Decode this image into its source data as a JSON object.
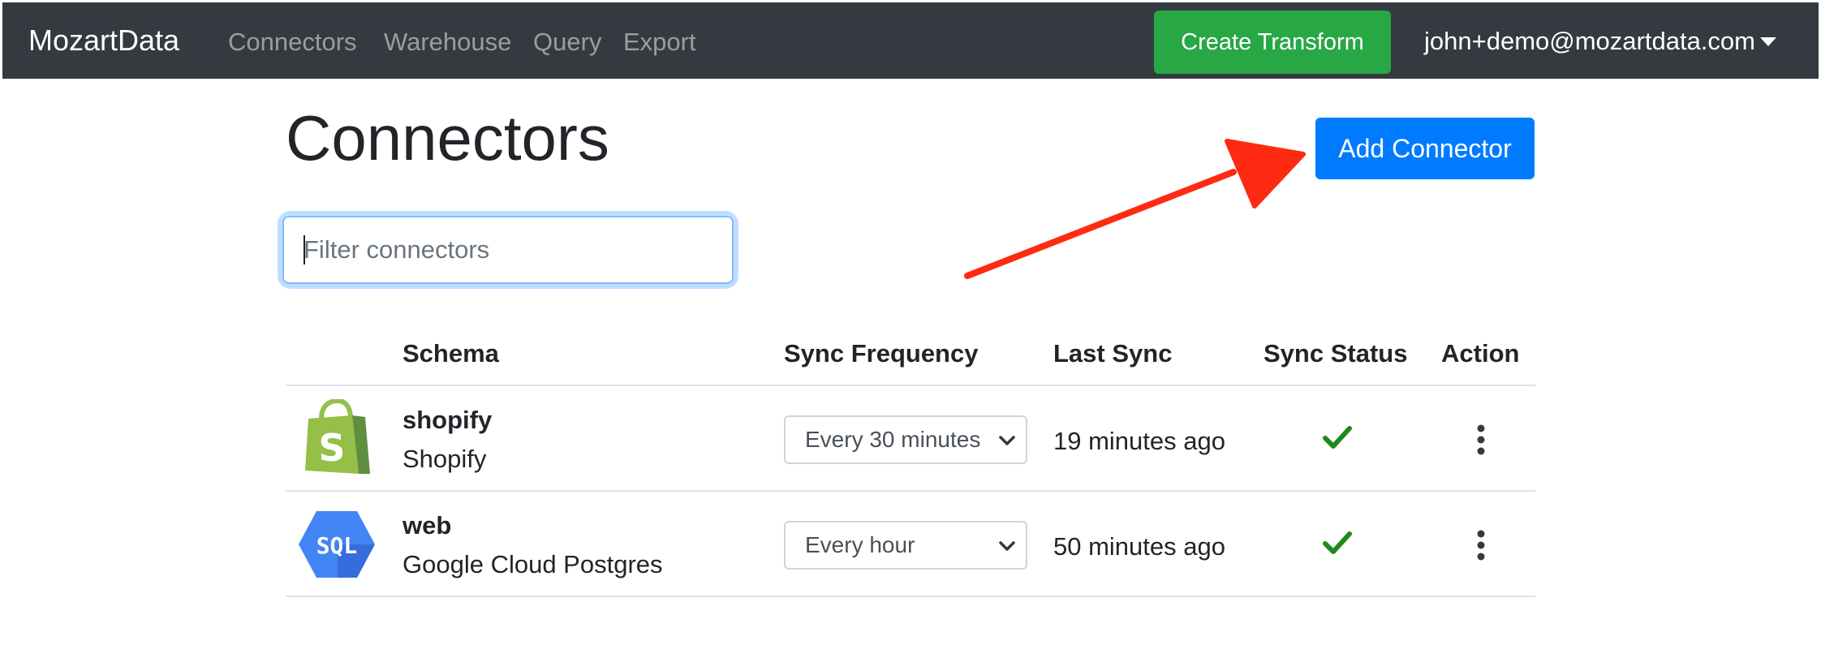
{
  "navbar": {
    "brand": "MozartData",
    "links": [
      "Connectors",
      "Warehouse",
      "Query",
      "Export"
    ],
    "create_button": "Create Transform",
    "user_email": "john+demo@mozartdata.com"
  },
  "page": {
    "title": "Connectors",
    "add_button": "Add Connector",
    "filter_placeholder": "Filter connectors"
  },
  "table": {
    "headers": {
      "schema": "Schema",
      "sync_frequency": "Sync Frequency",
      "last_sync": "Last Sync",
      "sync_status": "Sync Status",
      "action": "Action"
    },
    "rows": [
      {
        "name": "shopify",
        "service": "Shopify",
        "logo": "shopify-logo",
        "sync_frequency": "Every 30 minutes",
        "last_sync": "19 minutes ago",
        "status": "success-check-icon"
      },
      {
        "name": "web",
        "service": "Google Cloud Postgres",
        "logo": "google-cloud-sql-logo",
        "sync_frequency": "Every hour",
        "last_sync": "50 minutes ago",
        "status": "success-check-icon"
      }
    ]
  },
  "colors": {
    "navbar_bg": "#343a40",
    "create_button": "#28a745",
    "add_button": "#007bff",
    "check": "#1e8a1e",
    "annotation_arrow": "#ff2a12"
  }
}
